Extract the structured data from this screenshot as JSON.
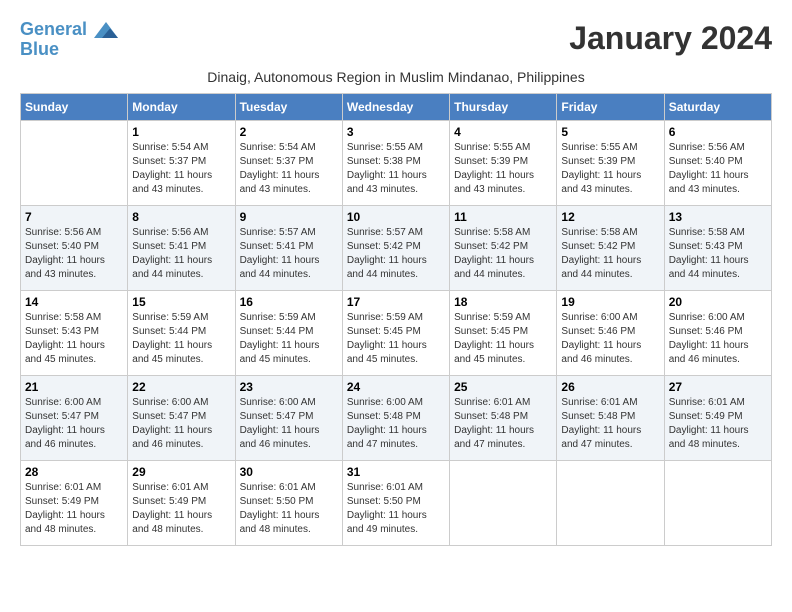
{
  "logo": {
    "line1": "General",
    "line2": "Blue"
  },
  "month_title": "January 2024",
  "location": "Dinaig, Autonomous Region in Muslim Mindanao, Philippines",
  "days_of_week": [
    "Sunday",
    "Monday",
    "Tuesday",
    "Wednesday",
    "Thursday",
    "Friday",
    "Saturday"
  ],
  "weeks": [
    [
      {
        "day": "",
        "info": ""
      },
      {
        "day": "1",
        "info": "Sunrise: 5:54 AM\nSunset: 5:37 PM\nDaylight: 11 hours\nand 43 minutes."
      },
      {
        "day": "2",
        "info": "Sunrise: 5:54 AM\nSunset: 5:37 PM\nDaylight: 11 hours\nand 43 minutes."
      },
      {
        "day": "3",
        "info": "Sunrise: 5:55 AM\nSunset: 5:38 PM\nDaylight: 11 hours\nand 43 minutes."
      },
      {
        "day": "4",
        "info": "Sunrise: 5:55 AM\nSunset: 5:39 PM\nDaylight: 11 hours\nand 43 minutes."
      },
      {
        "day": "5",
        "info": "Sunrise: 5:55 AM\nSunset: 5:39 PM\nDaylight: 11 hours\nand 43 minutes."
      },
      {
        "day": "6",
        "info": "Sunrise: 5:56 AM\nSunset: 5:40 PM\nDaylight: 11 hours\nand 43 minutes."
      }
    ],
    [
      {
        "day": "7",
        "info": "Sunrise: 5:56 AM\nSunset: 5:40 PM\nDaylight: 11 hours\nand 43 minutes."
      },
      {
        "day": "8",
        "info": "Sunrise: 5:56 AM\nSunset: 5:41 PM\nDaylight: 11 hours\nand 44 minutes."
      },
      {
        "day": "9",
        "info": "Sunrise: 5:57 AM\nSunset: 5:41 PM\nDaylight: 11 hours\nand 44 minutes."
      },
      {
        "day": "10",
        "info": "Sunrise: 5:57 AM\nSunset: 5:42 PM\nDaylight: 11 hours\nand 44 minutes."
      },
      {
        "day": "11",
        "info": "Sunrise: 5:58 AM\nSunset: 5:42 PM\nDaylight: 11 hours\nand 44 minutes."
      },
      {
        "day": "12",
        "info": "Sunrise: 5:58 AM\nSunset: 5:42 PM\nDaylight: 11 hours\nand 44 minutes."
      },
      {
        "day": "13",
        "info": "Sunrise: 5:58 AM\nSunset: 5:43 PM\nDaylight: 11 hours\nand 44 minutes."
      }
    ],
    [
      {
        "day": "14",
        "info": "Sunrise: 5:58 AM\nSunset: 5:43 PM\nDaylight: 11 hours\nand 45 minutes."
      },
      {
        "day": "15",
        "info": "Sunrise: 5:59 AM\nSunset: 5:44 PM\nDaylight: 11 hours\nand 45 minutes."
      },
      {
        "day": "16",
        "info": "Sunrise: 5:59 AM\nSunset: 5:44 PM\nDaylight: 11 hours\nand 45 minutes."
      },
      {
        "day": "17",
        "info": "Sunrise: 5:59 AM\nSunset: 5:45 PM\nDaylight: 11 hours\nand 45 minutes."
      },
      {
        "day": "18",
        "info": "Sunrise: 5:59 AM\nSunset: 5:45 PM\nDaylight: 11 hours\nand 45 minutes."
      },
      {
        "day": "19",
        "info": "Sunrise: 6:00 AM\nSunset: 5:46 PM\nDaylight: 11 hours\nand 46 minutes."
      },
      {
        "day": "20",
        "info": "Sunrise: 6:00 AM\nSunset: 5:46 PM\nDaylight: 11 hours\nand 46 minutes."
      }
    ],
    [
      {
        "day": "21",
        "info": "Sunrise: 6:00 AM\nSunset: 5:47 PM\nDaylight: 11 hours\nand 46 minutes."
      },
      {
        "day": "22",
        "info": "Sunrise: 6:00 AM\nSunset: 5:47 PM\nDaylight: 11 hours\nand 46 minutes."
      },
      {
        "day": "23",
        "info": "Sunrise: 6:00 AM\nSunset: 5:47 PM\nDaylight: 11 hours\nand 46 minutes."
      },
      {
        "day": "24",
        "info": "Sunrise: 6:00 AM\nSunset: 5:48 PM\nDaylight: 11 hours\nand 47 minutes."
      },
      {
        "day": "25",
        "info": "Sunrise: 6:01 AM\nSunset: 5:48 PM\nDaylight: 11 hours\nand 47 minutes."
      },
      {
        "day": "26",
        "info": "Sunrise: 6:01 AM\nSunset: 5:48 PM\nDaylight: 11 hours\nand 47 minutes."
      },
      {
        "day": "27",
        "info": "Sunrise: 6:01 AM\nSunset: 5:49 PM\nDaylight: 11 hours\nand 48 minutes."
      }
    ],
    [
      {
        "day": "28",
        "info": "Sunrise: 6:01 AM\nSunset: 5:49 PM\nDaylight: 11 hours\nand 48 minutes."
      },
      {
        "day": "29",
        "info": "Sunrise: 6:01 AM\nSunset: 5:49 PM\nDaylight: 11 hours\nand 48 minutes."
      },
      {
        "day": "30",
        "info": "Sunrise: 6:01 AM\nSunset: 5:50 PM\nDaylight: 11 hours\nand 48 minutes."
      },
      {
        "day": "31",
        "info": "Sunrise: 6:01 AM\nSunset: 5:50 PM\nDaylight: 11 hours\nand 49 minutes."
      },
      {
        "day": "",
        "info": ""
      },
      {
        "day": "",
        "info": ""
      },
      {
        "day": "",
        "info": ""
      }
    ]
  ]
}
